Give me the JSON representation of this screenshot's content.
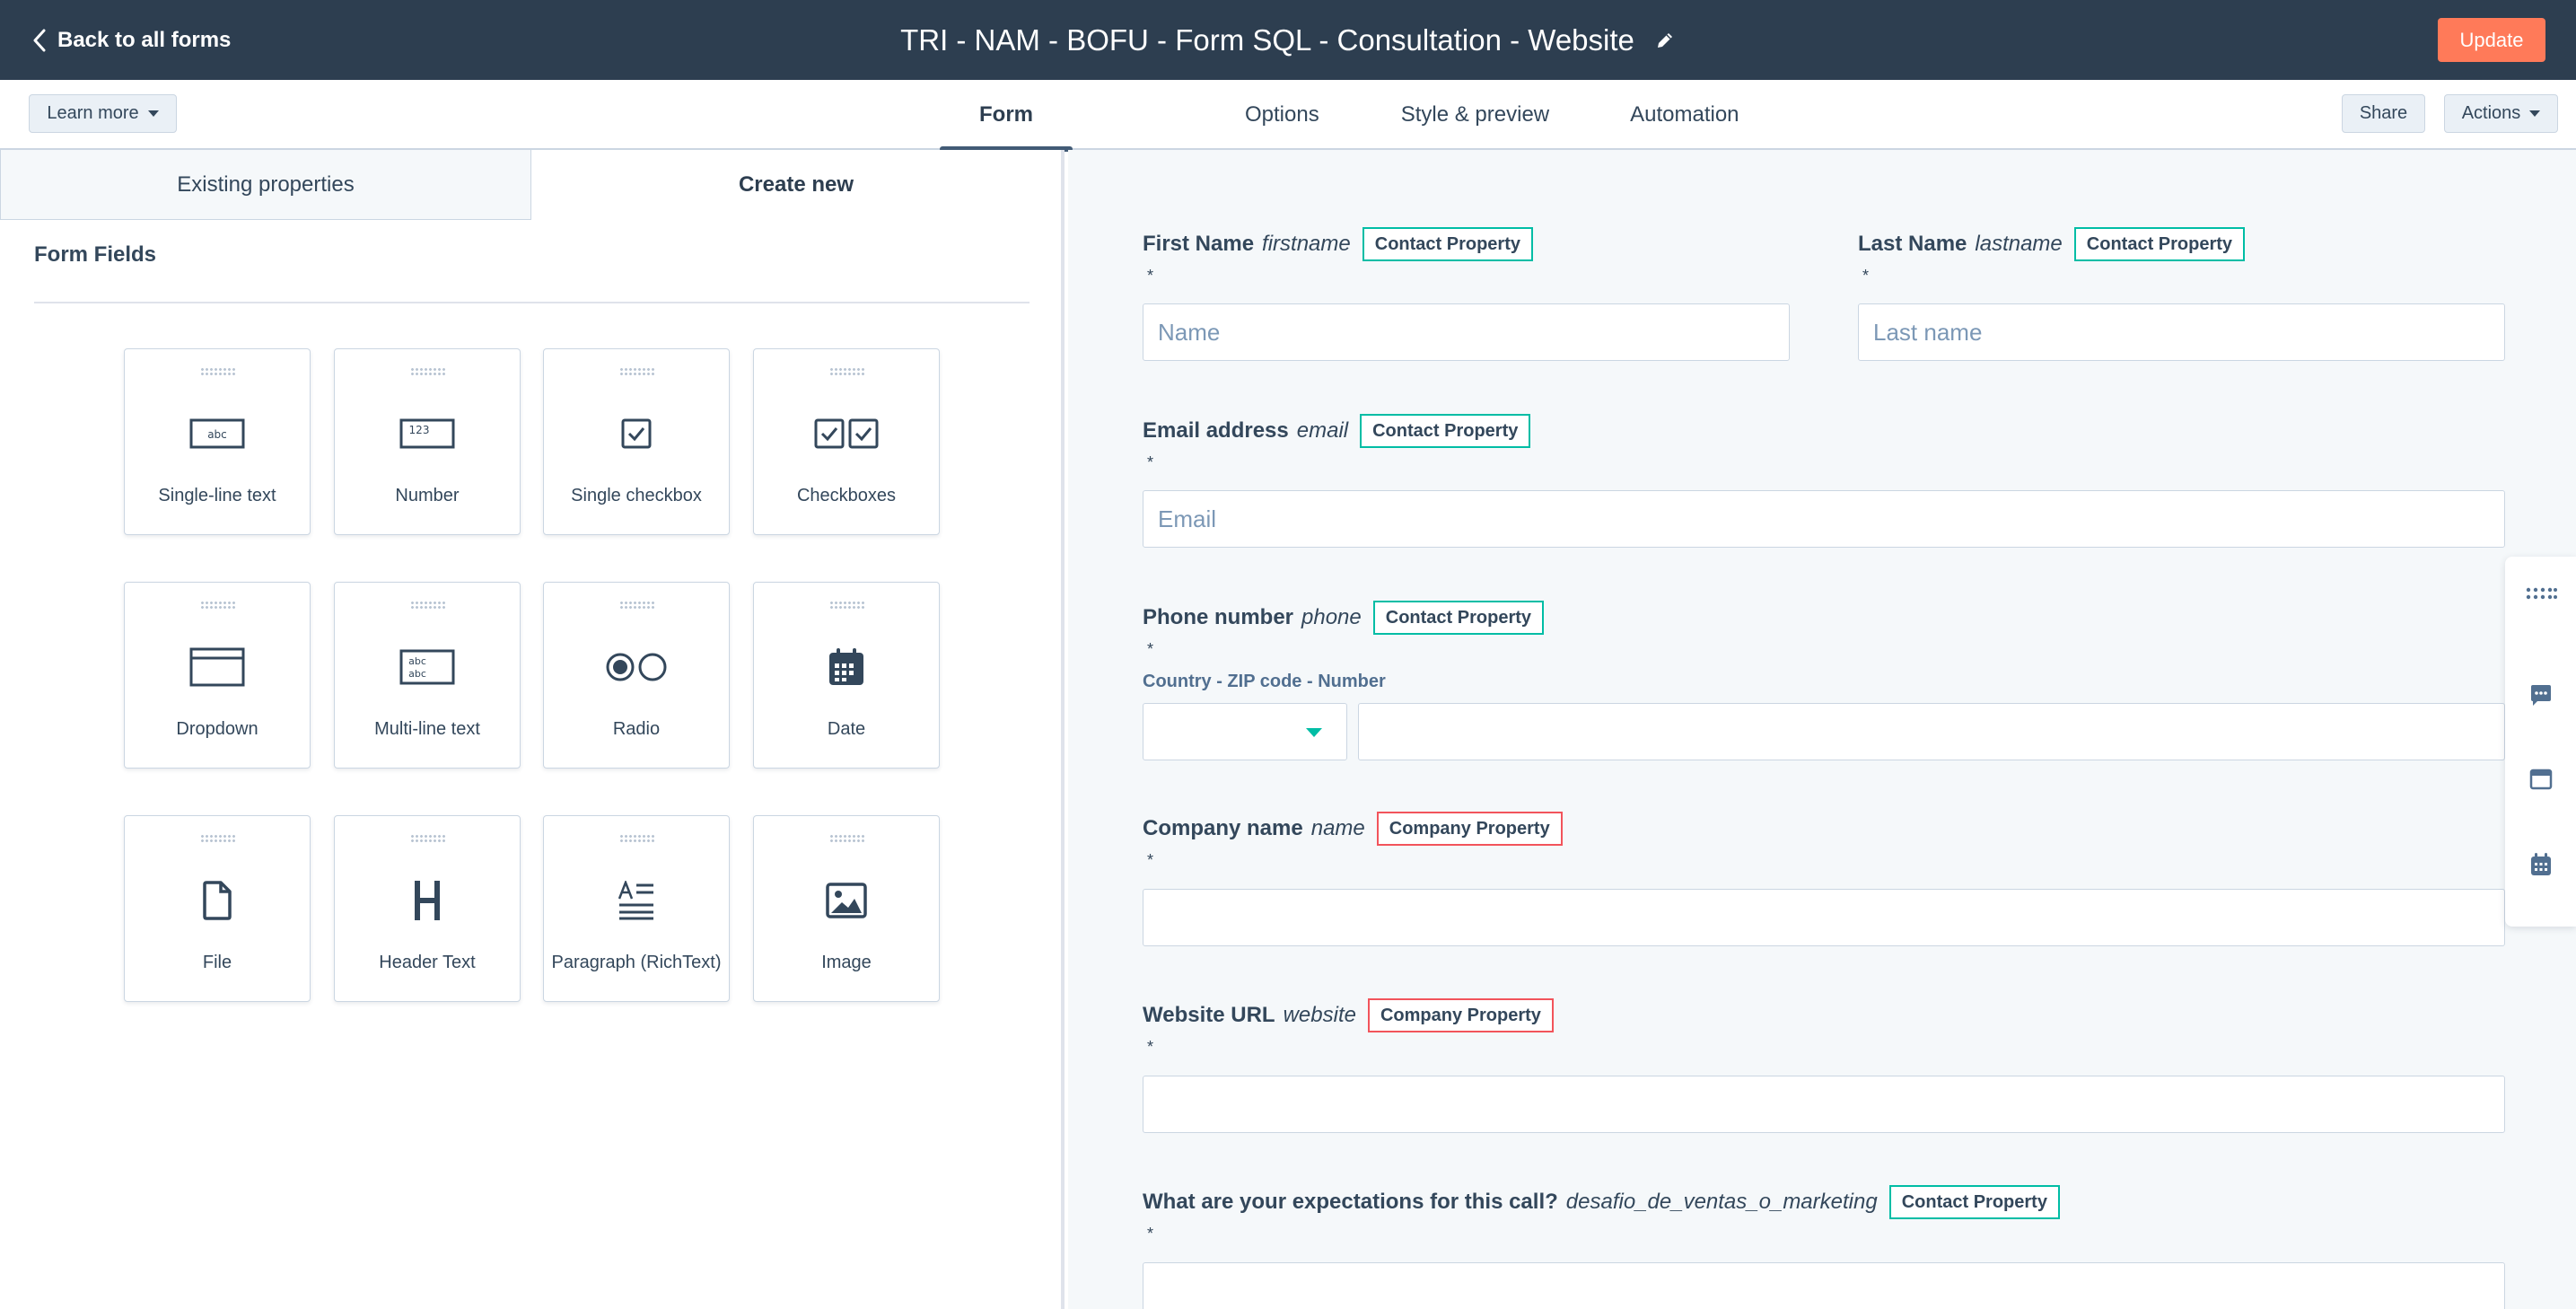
{
  "header": {
    "back_label": "Back to all forms",
    "title": "TRI - NAM - BOFU - Form SQL - Consultation - Website",
    "update_label": "Update"
  },
  "toolbar": {
    "learn_more": "Learn more",
    "tabs": [
      {
        "label": "Form",
        "active": true
      },
      {
        "label": "Options",
        "active": false
      },
      {
        "label": "Style & preview",
        "active": false
      },
      {
        "label": "Automation",
        "active": false
      }
    ],
    "share": "Share",
    "actions": "Actions"
  },
  "left_panel": {
    "tabs": [
      {
        "label": "Existing properties",
        "active": false
      },
      {
        "label": "Create new",
        "active": true
      }
    ],
    "section_title": "Form Fields",
    "field_types": [
      {
        "label": "Single-line text",
        "icon": "single-line-text-icon"
      },
      {
        "label": "Number",
        "icon": "number-icon"
      },
      {
        "label": "Single checkbox",
        "icon": "single-checkbox-icon"
      },
      {
        "label": "Checkboxes",
        "icon": "checkboxes-icon"
      },
      {
        "label": "Dropdown",
        "icon": "dropdown-icon"
      },
      {
        "label": "Multi-line text",
        "icon": "multi-line-text-icon"
      },
      {
        "label": "Radio",
        "icon": "radio-icon"
      },
      {
        "label": "Date",
        "icon": "calendar-icon"
      },
      {
        "label": "File",
        "icon": "file-icon"
      },
      {
        "label": "Header Text",
        "icon": "header-text-icon"
      },
      {
        "label": "Paragraph (RichText)",
        "icon": "paragraph-icon"
      },
      {
        "label": "Image",
        "icon": "image-icon"
      }
    ]
  },
  "form_preview": {
    "required_marker": "*",
    "fields": [
      {
        "label": "First Name",
        "property": "firstname",
        "badge": "Contact Property",
        "placeholder": "Name"
      },
      {
        "label": "Last Name",
        "property": "lastname",
        "badge": "Contact Property",
        "placeholder": "Last name"
      },
      {
        "label": "Email address",
        "property": "email",
        "badge": "Contact Property",
        "placeholder": "Email"
      },
      {
        "label": "Phone number",
        "property": "phone",
        "badge": "Contact Property",
        "sublabel": "Country - ZIP code - Number"
      },
      {
        "label": "Company name",
        "property": "name",
        "badge": "Company Property"
      },
      {
        "label": "Website URL",
        "property": "website",
        "badge": "Company Property"
      },
      {
        "label": "What are your expectations for this call?",
        "property": "desafio_de_ventas_o_marketing",
        "badge": "Contact Property"
      }
    ]
  },
  "side_rail": {
    "icons": [
      "grid-dots-icon",
      "chat-icon",
      "window-icon",
      "calendar-icon"
    ]
  },
  "colors": {
    "header_bg": "#2d3e50",
    "accent_orange": "#ff7a59",
    "contact_badge": "#00bda5",
    "company_badge": "#f2545b",
    "preview_bg": "#f5f8fa"
  }
}
